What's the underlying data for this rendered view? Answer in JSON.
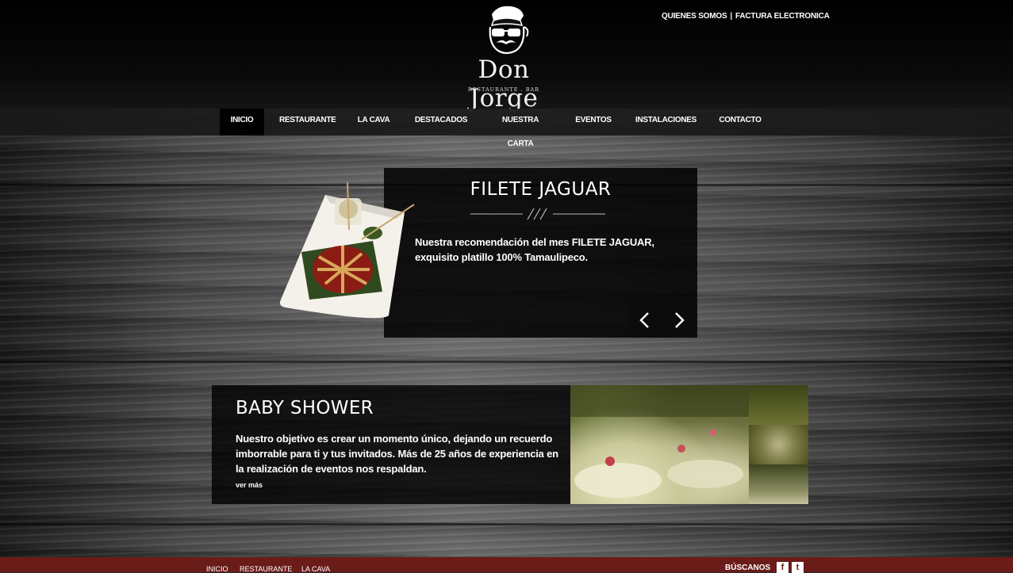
{
  "brand": {
    "name": "Don Jorge",
    "tagline": "RESTAURANTE . BAR"
  },
  "top_links": [
    "QUIENES SOMOS",
    "FACTURA ELECTRONICA"
  ],
  "top_links_separator": "|",
  "nav": {
    "items": [
      "INICIO",
      "RESTAURANTE",
      "LA CAVA",
      "DESTACADOS",
      "NUESTRA CARTA",
      "EVENTOS",
      "INSTALACIONES",
      "CONTACTO"
    ],
    "active": "INICIO"
  },
  "slider": {
    "title": "FILETE JAGUAR",
    "text": "Nuestra recomendación del mes FILETE JAGUAR, exquisito platillo 100% Tamaulipeco.",
    "prev_icon": "chevron-left-icon",
    "next_icon": "chevron-right-icon"
  },
  "event": {
    "title": "BABY SHOWER",
    "text": "Nuestro objetivo es crear un momento único, dejando un recuerdo imborrable para ti y tus invitados. Más de 25 años de experiencia en la realización de eventos nos respaldan.",
    "link": "ver más"
  },
  "footer": {
    "links": [
      "INICIO",
      "RESTAURANTE",
      "LA CAVA"
    ],
    "social_label": "BÚSCANOS",
    "social_icons": [
      "facebook-icon",
      "twitter-icon"
    ],
    "facebook_glyph": "f",
    "twitter_glyph": "t"
  },
  "colors": {
    "footer_bg": "#6a1c19",
    "nav_bg": "#191919",
    "panel_bg": "#000000"
  }
}
